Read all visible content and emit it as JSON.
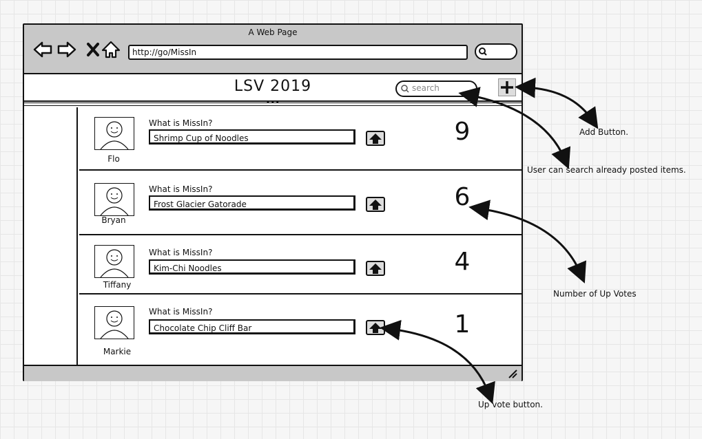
{
  "window": {
    "title": "A Web Page",
    "url": "http://go/MissIn"
  },
  "app": {
    "title": "LSV 2019",
    "search_placeholder": "search"
  },
  "posts": [
    {
      "user": "Flo",
      "question": "What is MissIn?",
      "answer": "Shrimp Cup of Noodles",
      "votes": "9"
    },
    {
      "user": "Bryan",
      "question": "What is MissIn?",
      "answer": "Frost Glacier Gatorade",
      "votes": "6"
    },
    {
      "user": "Tiffany",
      "question": "What is MissIn?",
      "answer": "Kim-Chi Noodles",
      "votes": "4"
    },
    {
      "user": "Markie",
      "question": "What is MissIn?",
      "answer": "Chocolate Chip Cliff Bar",
      "votes": "1"
    }
  ],
  "annotations": {
    "add_button": "Add Button.",
    "search": "User can search already posted items.",
    "votes": "Number of Up Votes",
    "upvote": "Up vote button."
  }
}
